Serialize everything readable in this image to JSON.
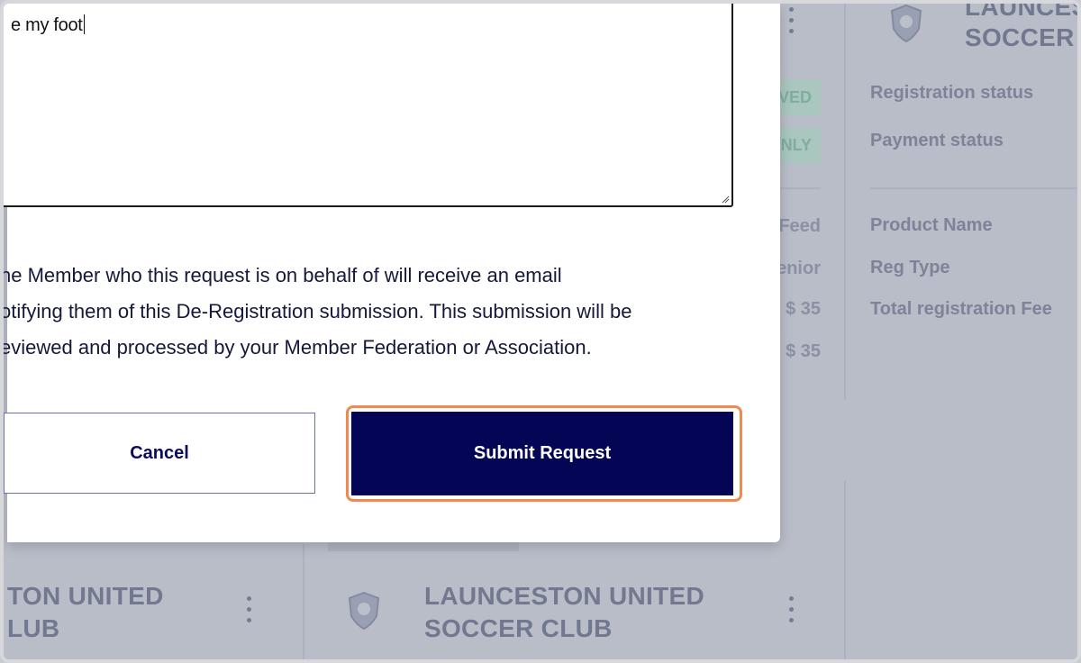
{
  "modal": {
    "textarea_value": "e my foot",
    "notice_lines": [
      "he Member who this request is on behalf of will receive an email",
      "otifying them of this De-Registration submission. This submission will be",
      "eviewed and processed by your Member Federation or Association."
    ],
    "cancel_label": "Cancel",
    "submit_label": "Submit Request"
  },
  "background": {
    "right_card": {
      "club_name_line1": "LAUNCES",
      "club_name_line2": "SOCCER C",
      "status_labels": [
        "Registration status",
        "Payment status"
      ],
      "detail_labels": [
        "Product Name",
        "Reg Type",
        "Total registration Fee"
      ]
    },
    "middle_partial": {
      "badges": [
        "VED",
        "NLY"
      ],
      "values": [
        "Feed",
        "enior",
        "$ 35",
        "$ 35"
      ]
    },
    "bottom_cards": [
      {
        "line1": "TON UNITED",
        "line2": "LUB"
      },
      {
        "line1": "LAUNCESTON UNITED",
        "line2": "SOCCER CLUB"
      }
    ],
    "colors": {
      "badge_bg": "#a9c6bf",
      "overlay": "#b9bdc8"
    }
  }
}
